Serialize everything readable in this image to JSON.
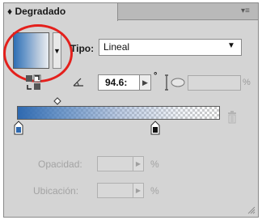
{
  "panel": {
    "title": "Degradado",
    "title_prefix": "♦",
    "menu_glyph": "▾≡"
  },
  "gradient_type": {
    "label": "Tipo:",
    "value": "Lineal",
    "arrow": "▼",
    "swatch_arrow": "▼"
  },
  "angle": {
    "value": "94.6:",
    "step_glyph": "▶",
    "degree_symbol": "°"
  },
  "aspect_ratio": {
    "value": "",
    "unit": "%"
  },
  "ramp": {
    "start_color": "#2e69b0",
    "end_color": "#ffffff"
  },
  "fields": [
    {
      "label": "Opacidad:",
      "value": "",
      "step_glyph": "▶",
      "unit": "%"
    },
    {
      "label": "Ubicación:",
      "value": "",
      "step_glyph": "▶",
      "unit": "%"
    }
  ],
  "colors": {
    "highlight_ring": "#e4201c",
    "panel_bg": "#d4d4d4",
    "disabled_text": "#a3a3a3"
  },
  "icons": [
    "reverse-gradient-icon",
    "angle-icon",
    "aspect-ratio-icon",
    "trash-icon",
    "gradient-stop-icon",
    "midpoint-diamond-icon",
    "resize-grip-icon"
  ]
}
